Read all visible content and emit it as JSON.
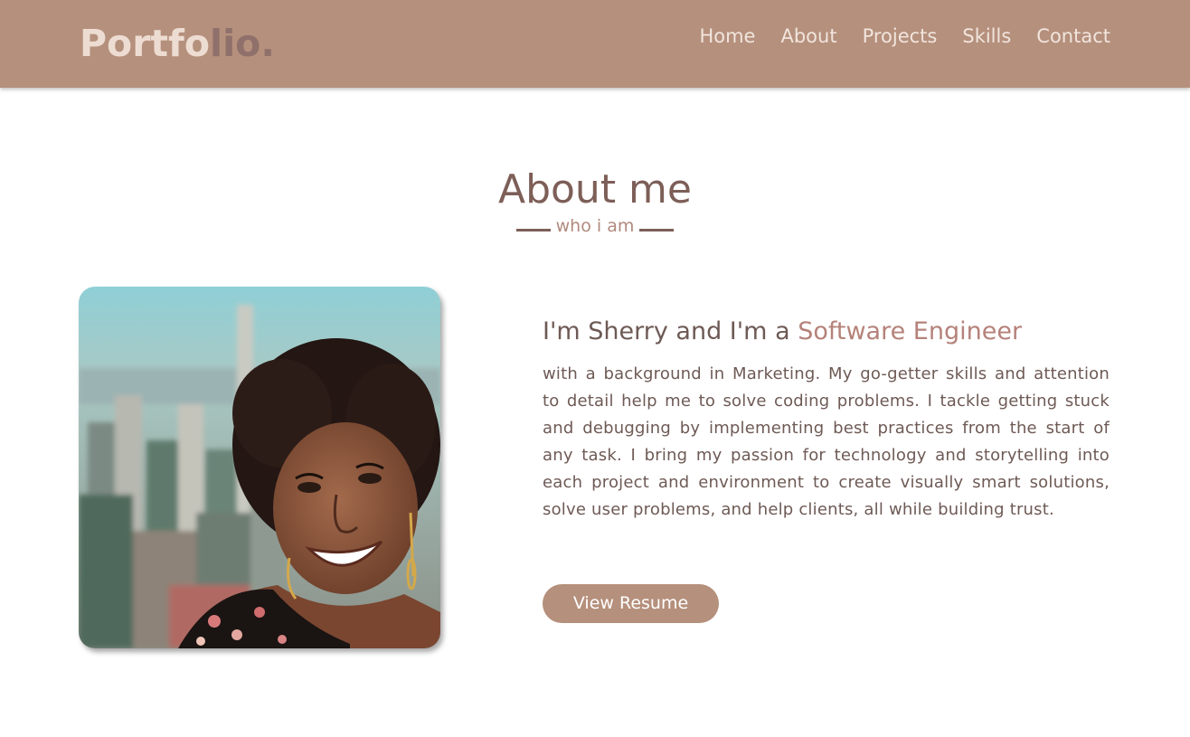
{
  "brand": {
    "part1": "Portfo",
    "part2": "lio."
  },
  "nav": [
    "Home",
    "About",
    "Projects",
    "Skills",
    "Contact"
  ],
  "about": {
    "title": "About me",
    "subtitle": "who i am",
    "heading_prefix": "I'm Sherry and I'm a ",
    "heading_accent": "Software Engineer",
    "bio": "with a background in Marketing. My go-getter skills and attention to detail help me to solve coding problems. I tackle getting stuck and debugging by implementing best practices from the start of any task. I bring my passion for technology and storytelling into each project and environment to create visually smart solutions, solve user problems, and help clients, all while building trust.",
    "button_label": "View Resume"
  },
  "colors": {
    "nav_bg": "#b5907c",
    "accent": "#b5827a",
    "text": "#6e5a55"
  }
}
